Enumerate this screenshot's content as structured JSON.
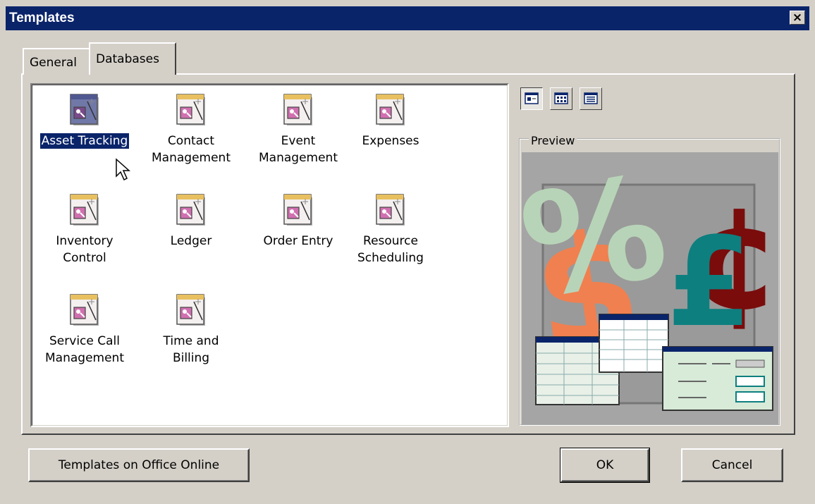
{
  "window": {
    "title": "Templates",
    "close_label": "×"
  },
  "tabs": [
    {
      "label": "General",
      "active": false
    },
    {
      "label": "Databases",
      "active": true
    }
  ],
  "templates": [
    {
      "label": "Asset Tracking",
      "selected": true
    },
    {
      "label": "Contact\nManagement",
      "selected": false
    },
    {
      "label": "Event\nManagement",
      "selected": false
    },
    {
      "label": "Expenses",
      "selected": false
    },
    {
      "label": "Inventory\nControl",
      "selected": false
    },
    {
      "label": "Ledger",
      "selected": false
    },
    {
      "label": "Order Entry",
      "selected": false
    },
    {
      "label": "Resource\nScheduling",
      "selected": false
    },
    {
      "label": "Service Call\nManagement",
      "selected": false
    },
    {
      "label": "Time and\nBilling",
      "selected": false
    }
  ],
  "view_buttons": [
    {
      "name": "large-icons",
      "pressed": true
    },
    {
      "name": "list",
      "pressed": false
    },
    {
      "name": "details",
      "pressed": false
    }
  ],
  "preview": {
    "legend": "Preview"
  },
  "buttons": {
    "online": "Templates on Office Online",
    "ok": "OK",
    "cancel": "Cancel"
  },
  "colors": {
    "titlebar": "#0a246a",
    "selection": "#0a246a",
    "dialog": "#d4d0c8"
  }
}
